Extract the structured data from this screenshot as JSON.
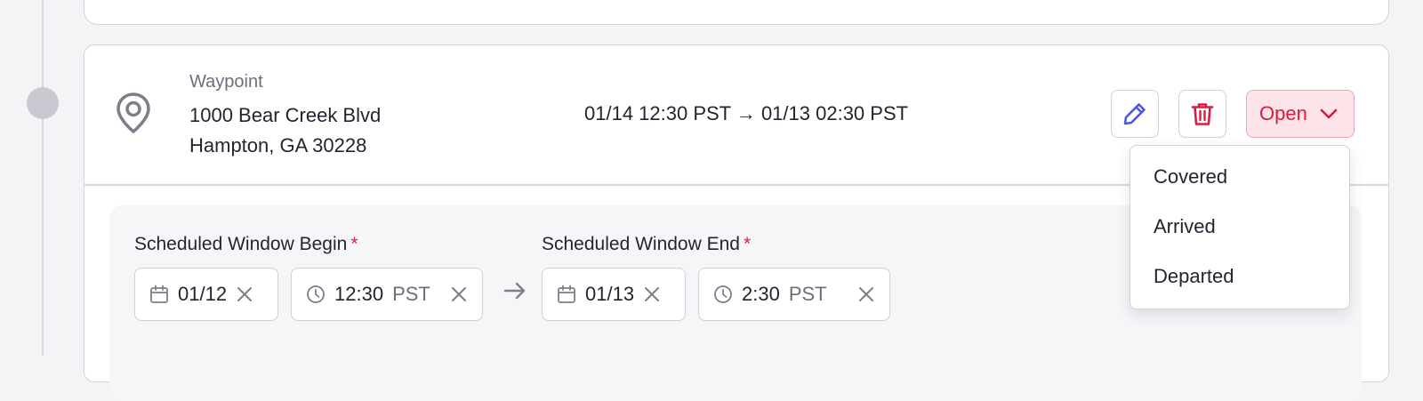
{
  "waypoint": {
    "type_label": "Waypoint",
    "address_line1": "1000 Bear Creek Blvd",
    "address_line2": "Hampton, GA 30228",
    "window_summary": "01/14 12:30 PST → 01/13 02:30 PST",
    "status_label": "Open"
  },
  "status_menu": {
    "options": [
      "Covered",
      "Arrived",
      "Departed"
    ]
  },
  "form": {
    "begin_label": "Scheduled Window Begin",
    "end_label": "Scheduled Window End",
    "required_marker": "*",
    "begin_date": "01/12",
    "begin_time": "12:30",
    "begin_tz": "PST",
    "end_date": "01/13",
    "end_time": "2:30",
    "end_tz": "PST"
  },
  "icons": {
    "pin": "map-pin-icon",
    "edit": "pencil-icon",
    "delete": "trash-icon",
    "chevron": "chevron-down-icon",
    "calendar": "calendar-icon",
    "clock": "clock-icon",
    "clear": "close-icon",
    "arrow": "arrow-right-icon"
  },
  "colors": {
    "accent_blue": "#4f5bd5",
    "danger_red": "#d81b3f",
    "status_bg": "#fde4e8",
    "required_red": "#e11d48"
  }
}
